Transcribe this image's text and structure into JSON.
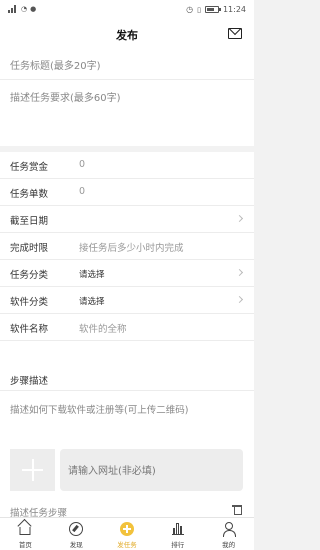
{
  "status_bar": {
    "time": "11:24"
  },
  "nav": {
    "title": "发布"
  },
  "task_title_placeholder": "任务标题(最多20字)",
  "task_desc_placeholder": "描述任务要求(最多60字)",
  "form": {
    "rows": [
      {
        "label": "任务赏金",
        "value": "0"
      },
      {
        "label": "任务单数",
        "value": "0"
      },
      {
        "label": "截至日期",
        "value": ""
      },
      {
        "label": "完成时限",
        "value": "接任务后多少小时内完成"
      },
      {
        "label": "任务分类",
        "value": "请选择"
      },
      {
        "label": "软件分类",
        "value": "请选择"
      },
      {
        "label": "软件名称",
        "value": "软件的全称"
      }
    ]
  },
  "steps": {
    "header": "步骤描述",
    "description_placeholder": "描述如何下载软件或注册等(可上传二维码)",
    "url_placeholder": "请输入网址(非必填)",
    "next_step_placeholder": "描述任务步骤"
  },
  "tabbar": {
    "tabs": [
      {
        "label": "首页",
        "icon": "home-icon"
      },
      {
        "label": "发现",
        "icon": "compass-icon"
      },
      {
        "label": "发任务",
        "icon": "plus-icon"
      },
      {
        "label": "排行",
        "icon": "rank-icon"
      },
      {
        "label": "我的",
        "icon": "user-icon"
      }
    ]
  },
  "colors": {
    "accent": "#f2c23c",
    "background": "#f2f2f2"
  }
}
